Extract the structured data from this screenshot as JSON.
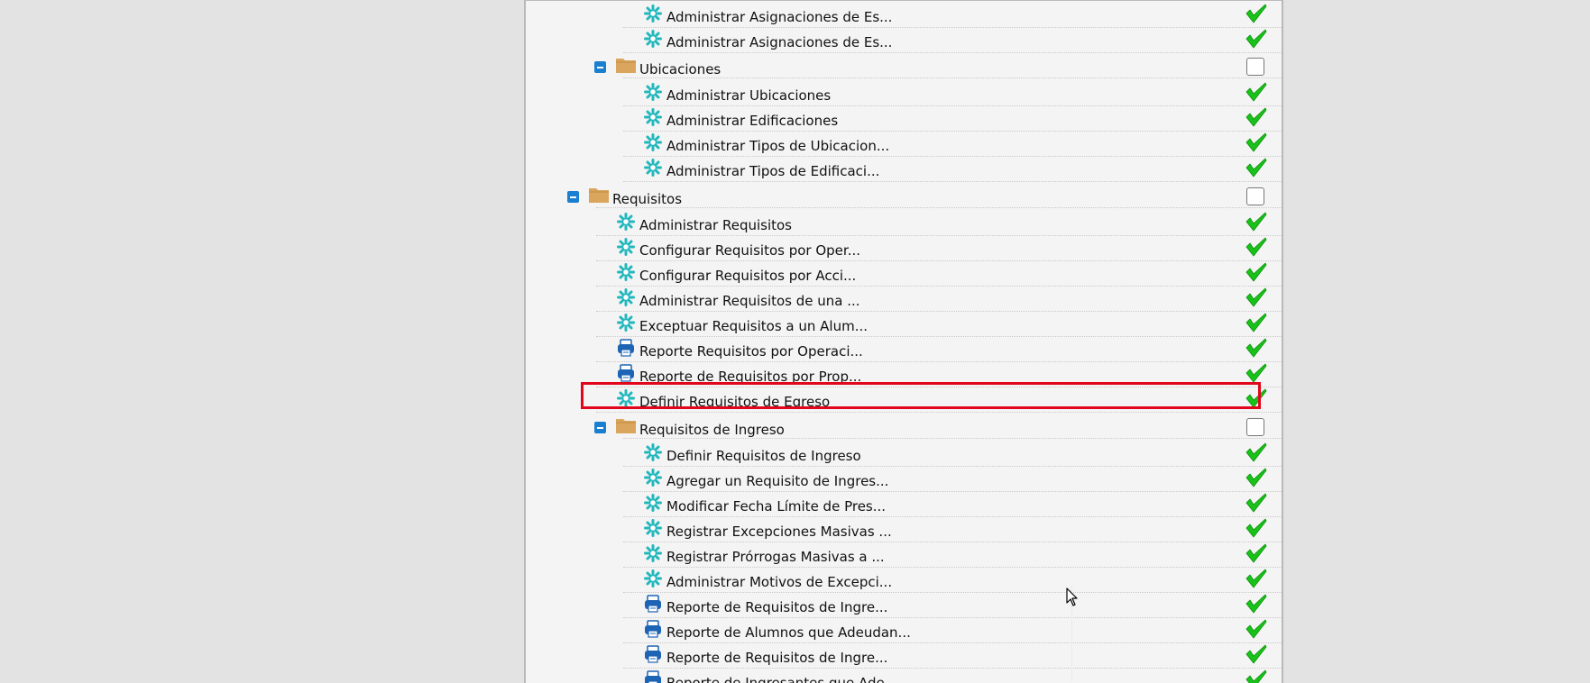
{
  "tree": {
    "rows": [
      {
        "type": "item",
        "icon": "gear",
        "label": "Administrar Asignaciones de Es...",
        "state": "checked"
      },
      {
        "type": "item",
        "icon": "gear",
        "label": "Administrar Asignaciones de Es...",
        "state": "checked"
      },
      {
        "type": "folder",
        "label": "Ubicaciones",
        "state": "unchecked"
      },
      {
        "type": "item",
        "icon": "gear",
        "label": "Administrar Ubicaciones",
        "state": "checked"
      },
      {
        "type": "item",
        "icon": "gear",
        "label": "Administrar Edificaciones",
        "state": "checked"
      },
      {
        "type": "item",
        "icon": "gear",
        "label": "Administrar Tipos de Ubicacion...",
        "state": "checked"
      },
      {
        "type": "item",
        "icon": "gear",
        "label": "Administrar Tipos de Edificaci...",
        "state": "checked"
      },
      {
        "type": "folder",
        "label": "Requisitos",
        "state": "unchecked"
      },
      {
        "type": "item",
        "icon": "gear",
        "label": "Administrar Requisitos",
        "state": "checked"
      },
      {
        "type": "item",
        "icon": "gear",
        "label": "Configurar Requisitos por Oper...",
        "state": "checked"
      },
      {
        "type": "item",
        "icon": "gear",
        "label": "Configurar Requisitos por Acci...",
        "state": "checked"
      },
      {
        "type": "item",
        "icon": "gear",
        "label": "Administrar Requisitos de una ...",
        "state": "checked"
      },
      {
        "type": "item",
        "icon": "gear",
        "label": "Exceptuar Requisitos a un Alum...",
        "state": "checked"
      },
      {
        "type": "item",
        "icon": "printer",
        "label": "Reporte Requisitos por Operaci...",
        "state": "checked"
      },
      {
        "type": "item",
        "icon": "printer",
        "label": "Reporte de Requisitos por Prop...",
        "state": "checked"
      },
      {
        "type": "item",
        "icon": "gear",
        "label": "Definir Requisitos de Egreso",
        "state": "checked",
        "highlighted": true
      },
      {
        "type": "folder",
        "label": "Requisitos de Ingreso",
        "state": "unchecked"
      },
      {
        "type": "item",
        "icon": "gear",
        "label": "Definir Requisitos de Ingreso",
        "state": "checked"
      },
      {
        "type": "item",
        "icon": "gear",
        "label": "Agregar un Requisito de Ingres...",
        "state": "checked"
      },
      {
        "type": "item",
        "icon": "gear",
        "label": "Modificar Fecha Límite de Pres...",
        "state": "checked"
      },
      {
        "type": "item",
        "icon": "gear",
        "label": "Registrar Excepciones Masivas ...",
        "state": "checked"
      },
      {
        "type": "item",
        "icon": "gear",
        "label": "Registrar Prórrogas Masivas a ...",
        "state": "checked"
      },
      {
        "type": "item",
        "icon": "gear",
        "label": "Administrar Motivos de Excepci...",
        "state": "checked"
      },
      {
        "type": "item",
        "icon": "printer",
        "label": "Reporte de Requisitos de Ingre...",
        "state": "checked"
      },
      {
        "type": "item",
        "icon": "printer",
        "label": "Reporte de Alumnos que Adeudan...",
        "state": "checked"
      },
      {
        "type": "item",
        "icon": "printer",
        "label": "Reporte de Requisitos de Ingre...",
        "state": "checked"
      },
      {
        "type": "item",
        "icon": "printer",
        "label": "Reporte de Ingresantes que Ade...",
        "state": "checked"
      }
    ]
  },
  "colors": {
    "highlight_border": "#e1061b",
    "check_green": "#18c218",
    "gear_teal": "#22b7bd",
    "printer_blue": "#1e64b4",
    "folder_tan": "#d9a55c",
    "toggle_blue": "#1a7fd0"
  }
}
